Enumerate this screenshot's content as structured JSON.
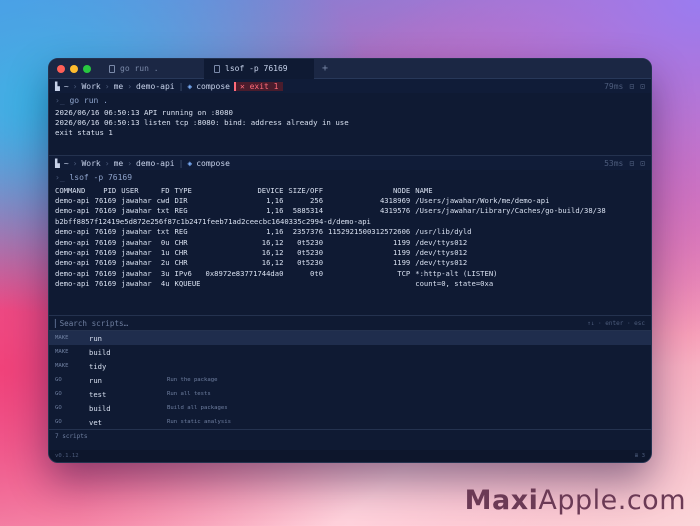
{
  "colors": {
    "red": "#ff5f57",
    "yellow": "#febc2e",
    "green": "#28c840",
    "accent": "#7fb3ff",
    "error": "#ff6b7a"
  },
  "tabs": [
    {
      "label": "go run .",
      "active": false
    },
    {
      "label": "lsof -p 76169",
      "active": true
    }
  ],
  "tab_add": "+",
  "pane1": {
    "crumbs": [
      "~",
      "Work",
      "me",
      "demo-api"
    ],
    "branch": "compose",
    "error": "exit 1",
    "right": [
      "79ms",
      "⊟",
      "⊡"
    ],
    "command": "go run .",
    "output": [
      "2026/06/16 06:50:13 API running on :8080",
      "2026/06/16 06:50:13 listen tcp :8080: bind: address already in use",
      "exit status 1"
    ]
  },
  "pane2": {
    "crumbs": [
      "~",
      "Work",
      "me",
      "demo-api"
    ],
    "branch": "compose",
    "right": [
      "53ms",
      "⊟",
      "⊡"
    ],
    "command": "lsof -p 76169",
    "header": [
      "COMMAND",
      "PID",
      "USER",
      "FD",
      "TYPE",
      "DEVICE",
      "SIZE/OFF",
      "NODE",
      "NAME"
    ],
    "rows": [
      [
        "demo-api",
        "76169",
        "jawahar",
        "cwd",
        "DIR",
        "1,16",
        "256",
        "4318969",
        "/Users/jawahar/Work/me/demo-api"
      ],
      [
        "demo-api",
        "76169",
        "jawahar",
        "txt",
        "REG",
        "1,16",
        "5885314",
        "4319576",
        "/Users/jawahar/Library/Caches/go-build/38/38"
      ],
      [
        "b2bff8857f12419e5d872e256f87c1b2471feeb71ad2ceecbc1640335c2994-d/demo-api",
        "",
        "",
        "",
        "",
        "",
        "",
        "",
        ""
      ],
      [
        "demo-api",
        "76169",
        "jawahar",
        "txt",
        "REG",
        "1,16",
        "2357376",
        "1152921500312572606",
        "/usr/lib/dyld"
      ],
      [
        "demo-api",
        "76169",
        "jawahar",
        "0u",
        "CHR",
        "16,12",
        "0t5230",
        "1199",
        "/dev/ttys012"
      ],
      [
        "demo-api",
        "76169",
        "jawahar",
        "1u",
        "CHR",
        "16,12",
        "0t5230",
        "1199",
        "/dev/ttys012"
      ],
      [
        "demo-api",
        "76169",
        "jawahar",
        "2u",
        "CHR",
        "16,12",
        "0t5230",
        "1199",
        "/dev/ttys012"
      ],
      [
        "demo-api",
        "76169",
        "jawahar",
        "3u",
        "IPv6",
        "0x8972e83771744da0",
        "0t0",
        "TCP",
        "*:http-alt (LISTEN)"
      ],
      [
        "demo-api",
        "76169",
        "jawahar",
        "4u",
        "KQUEUE",
        "",
        "",
        "",
        "count=0, state=0xa"
      ]
    ]
  },
  "scripts": {
    "placeholder": "Search scripts…",
    "hint": "↑↓ · enter · esc",
    "items": [
      {
        "kind": "MAKE",
        "name": "run",
        "desc": ""
      },
      {
        "kind": "MAKE",
        "name": "build",
        "desc": ""
      },
      {
        "kind": "MAKE",
        "name": "tidy",
        "desc": ""
      },
      {
        "kind": "GO",
        "name": "run",
        "desc": "Run the package"
      },
      {
        "kind": "GO",
        "name": "test",
        "desc": "Run all tests"
      },
      {
        "kind": "GO",
        "name": "build",
        "desc": "Build all packages"
      },
      {
        "kind": "GO",
        "name": "vet",
        "desc": "Run static analysis"
      }
    ],
    "count": "7 scripts"
  },
  "status": {
    "left": "v0.1.12",
    "right": "⊞ 3"
  },
  "watermark": {
    "bold": "Maxi",
    "rest": "Apple.com"
  }
}
